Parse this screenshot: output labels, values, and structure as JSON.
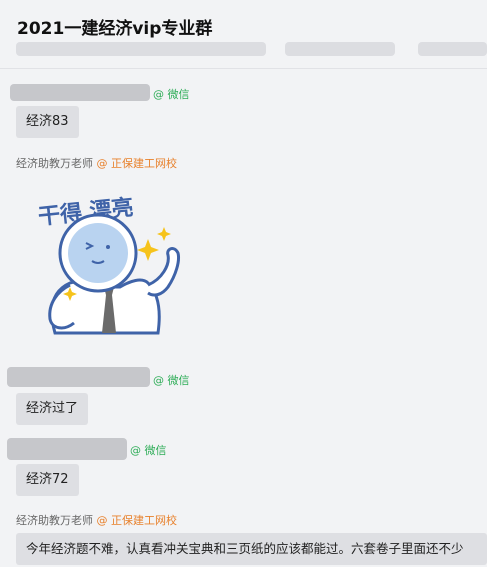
{
  "group": {
    "title": "2021一建经济vip专业群"
  },
  "colors": {
    "background": "#f2f3f5",
    "bubble": "#dedfe3",
    "wechat_tag": "#2fad58",
    "school_tag": "#e8812c"
  },
  "messages": [
    {
      "sender_tag": "@ 微信",
      "text": "经济83"
    },
    {
      "sender_name": "经济助教万老师",
      "sender_tag": "@ 正保建工网校",
      "sticker_text": "干得 漂亮",
      "sticker_icon": "well-done-sticker"
    },
    {
      "sender_tag": "@ 微信",
      "text": "经济过了"
    },
    {
      "sender_tag": "@ 微信",
      "text": "经济72"
    },
    {
      "sender_name": "经济助教万老师",
      "sender_tag": "@ 正保建工网校",
      "text": "今年经济题不难，认真看冲关宝典和三页纸的应该都能过。六套卷子里面还不少"
    }
  ]
}
